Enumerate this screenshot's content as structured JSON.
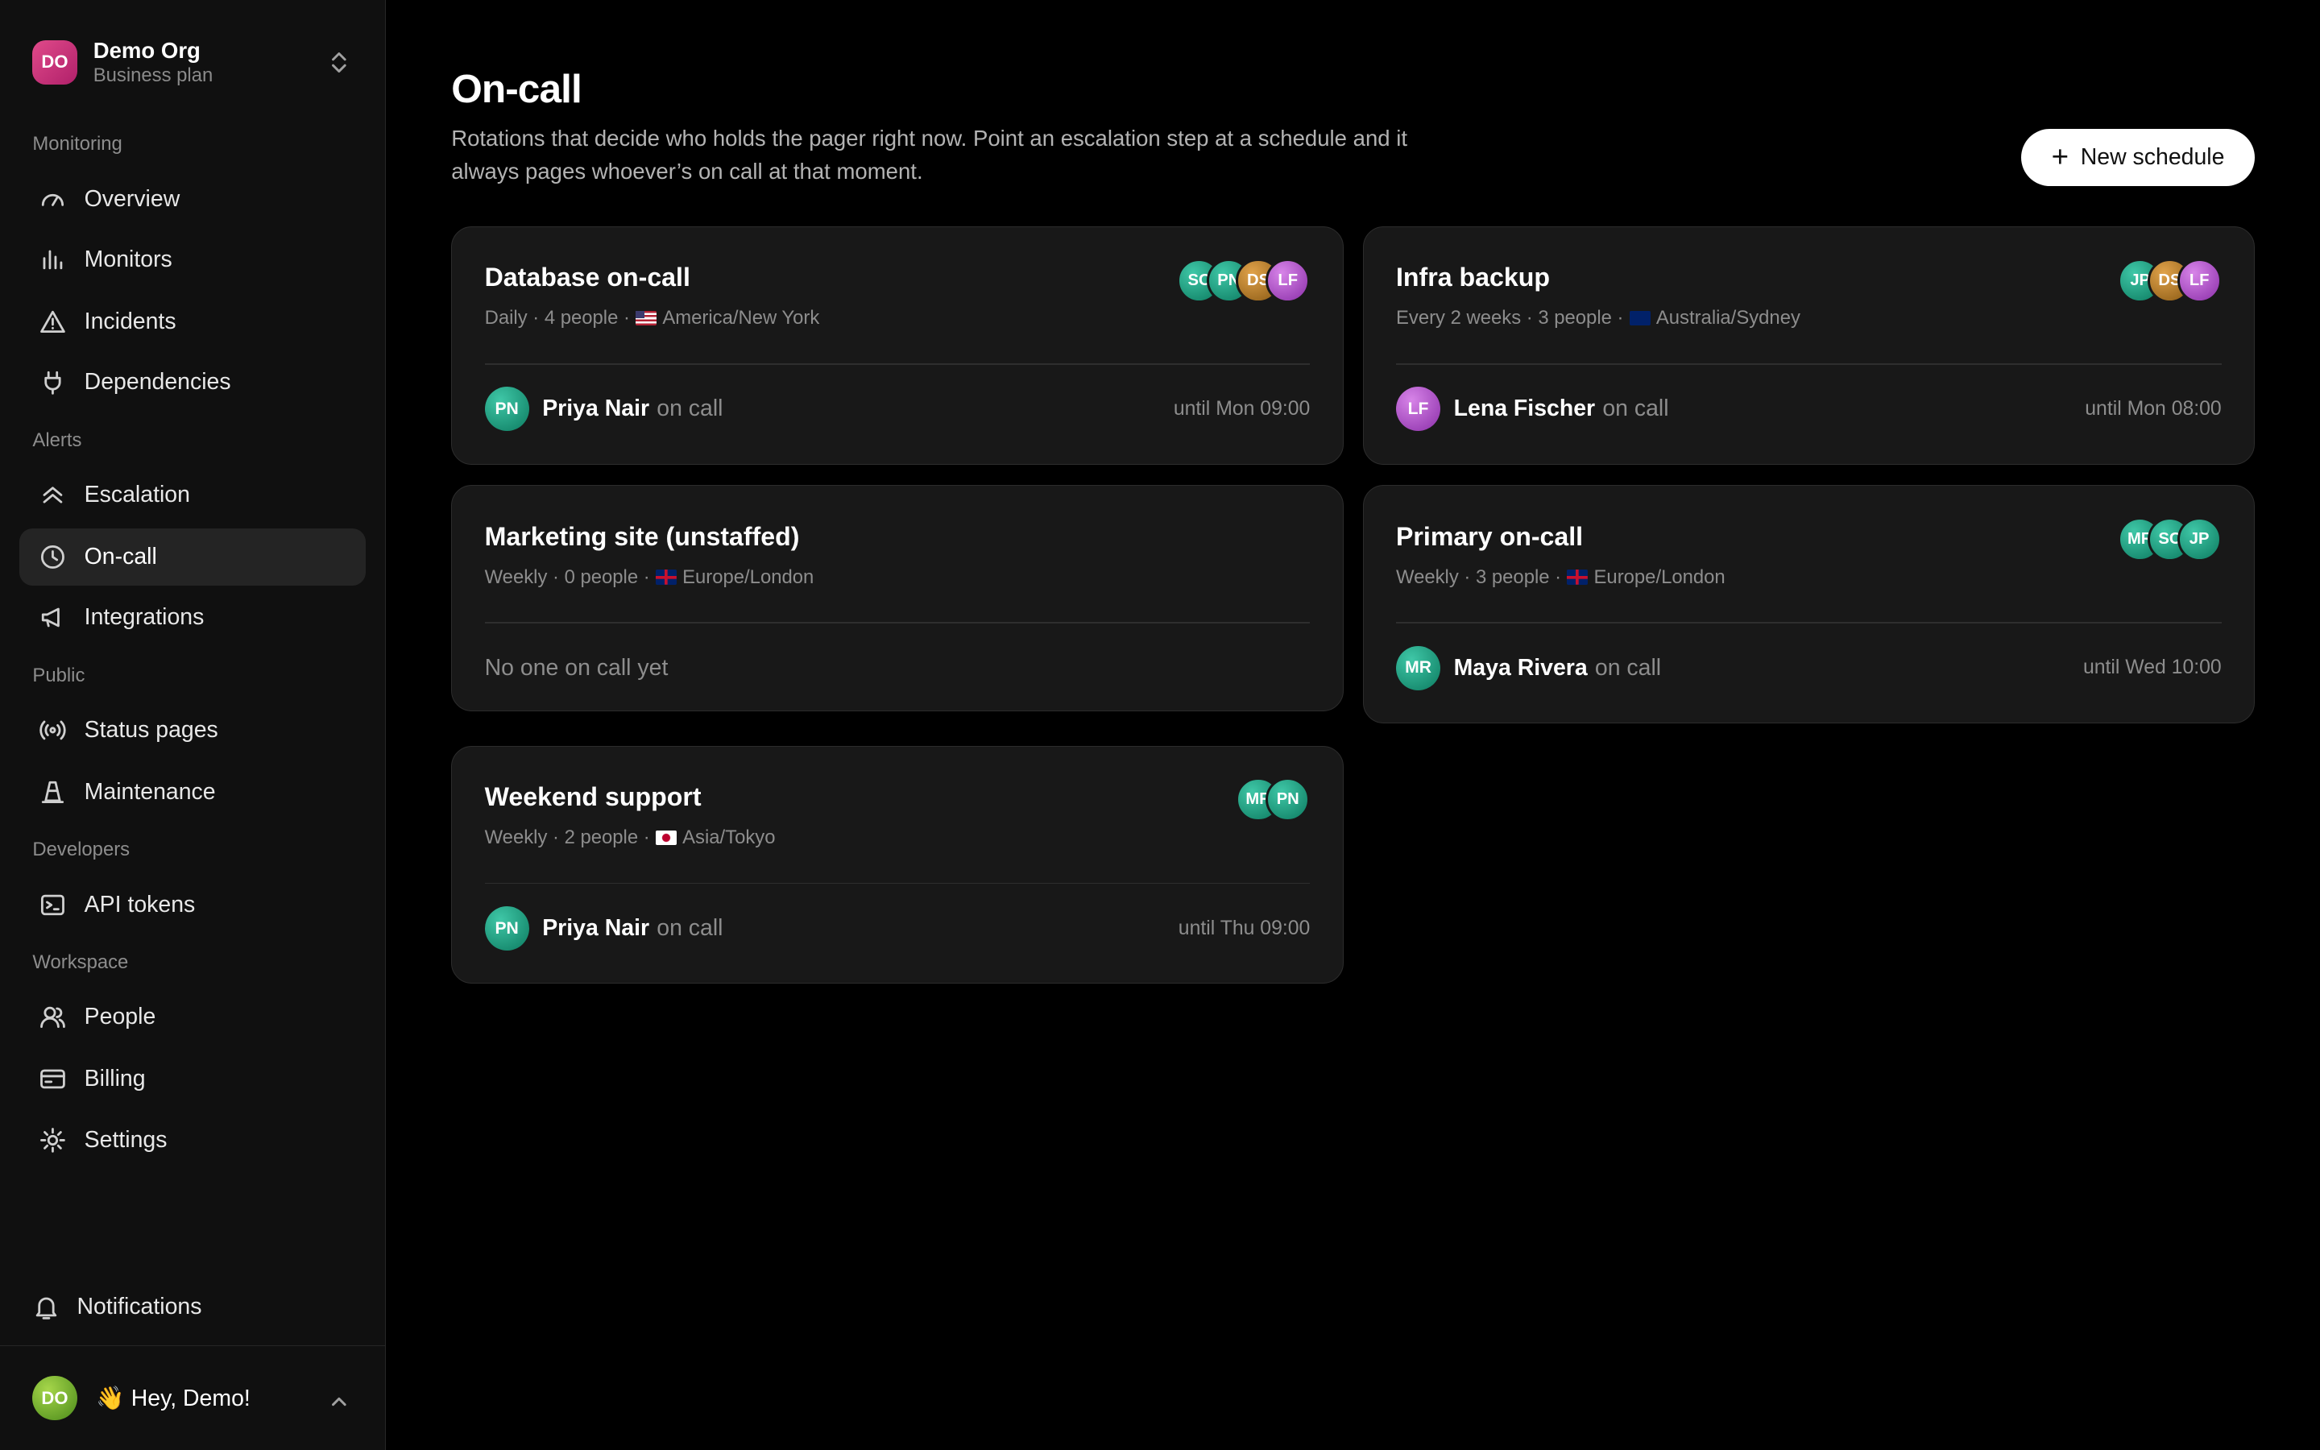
{
  "org": {
    "initials": "DO",
    "name": "Demo Org",
    "plan": "Business plan"
  },
  "sections": {
    "monitoring": "Monitoring",
    "alerts": "Alerts",
    "public": "Public",
    "developers": "Developers",
    "workspace": "Workspace"
  },
  "nav": {
    "overview": "Overview",
    "monitors": "Monitors",
    "incidents": "Incidents",
    "dependencies": "Dependencies",
    "escalation": "Escalation",
    "oncall": "On-call",
    "integrations": "Integrations",
    "status_pages": "Status pages",
    "maintenance": "Maintenance",
    "api_tokens": "API tokens",
    "people": "People",
    "billing": "Billing",
    "settings": "Settings"
  },
  "notifications": "Notifications",
  "user": {
    "initials": "DO",
    "greeting": "👋 Hey, Demo!"
  },
  "header": {
    "title": "On-call",
    "description": "Rotations that decide who holds the pager right now. Point an escalation step at a schedule and it always pages whoever’s on call at that moment.",
    "new_button": "New schedule"
  },
  "on_call_label": "on call",
  "schedules": [
    {
      "title": "Database on-call",
      "meta_prefix": "Daily · 4 people ·",
      "timezone": "America/New York",
      "flag": "us-flag-icon",
      "avatars": [
        "SC",
        "PN",
        "DS",
        "LF"
      ],
      "oncall_initials": "PN",
      "oncall_name": "Priya Nair",
      "until": "until Mon 09:00"
    },
    {
      "title": "Infra backup",
      "meta_prefix": "Every 2 weeks · 3 people ·",
      "timezone": "Australia/Sydney",
      "flag": "au-flag-icon",
      "avatars": [
        "JP",
        "DS",
        "LF"
      ],
      "oncall_initials": "LF",
      "oncall_name": "Lena Fischer",
      "until": "until Mon 08:00"
    },
    {
      "title": "Marketing site (unstaffed)",
      "meta_prefix": "Weekly · 0 people ·",
      "timezone": "Europe/London",
      "flag": "gb-flag-icon",
      "empty_text": "No one on call yet"
    },
    {
      "title": "Primary on-call",
      "meta_prefix": "Weekly · 3 people ·",
      "timezone": "Europe/London",
      "flag": "gb-flag-icon",
      "avatars": [
        "MR",
        "SC",
        "JP"
      ],
      "oncall_initials": "MR",
      "oncall_name": "Maya Rivera",
      "until": "until Wed 10:00"
    },
    {
      "title": "Weekend support",
      "meta_prefix": "Weekly · 2 people ·",
      "timezone": "Asia/Tokyo",
      "flag": "jp-flag-icon",
      "avatars": [
        "MR",
        "PN"
      ],
      "oncall_initials": "PN",
      "oncall_name": "Priya Nair",
      "until": "until Thu 09:00"
    }
  ]
}
